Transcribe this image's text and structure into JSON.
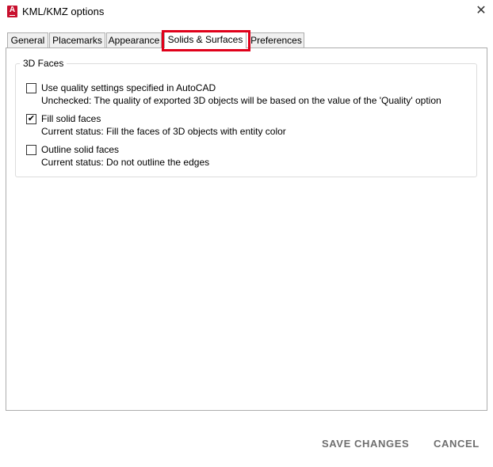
{
  "window": {
    "title": "KML/KMZ options",
    "app_icon": "autocad-icon",
    "app_icon_glyph": "A",
    "close_glyph": "✕"
  },
  "tabs": [
    {
      "label": "General",
      "selected": false
    },
    {
      "label": "Placemarks",
      "selected": false
    },
    {
      "label": "Appearance",
      "selected": false
    },
    {
      "label": "Solids & Surfaces",
      "selected": true
    },
    {
      "label": "Preferences",
      "selected": false
    }
  ],
  "highlight_color": "#e0001a",
  "group": {
    "title": "3D Faces",
    "options": [
      {
        "label": "Use quality settings specified in AutoCAD",
        "checked": false,
        "description": "Unchecked: The quality of exported 3D objects will be based on the value of the 'Quality' option"
      },
      {
        "label": "Fill solid faces",
        "checked": true,
        "description": "Current status: Fill the faces of 3D objects with entity color"
      },
      {
        "label": "Outline solid faces",
        "checked": false,
        "description": "Current status: Do not outline the edges"
      }
    ]
  },
  "footer": {
    "save_label": "SAVE CHANGES",
    "cancel_label": "CANCEL"
  },
  "check_glyph": "✔"
}
